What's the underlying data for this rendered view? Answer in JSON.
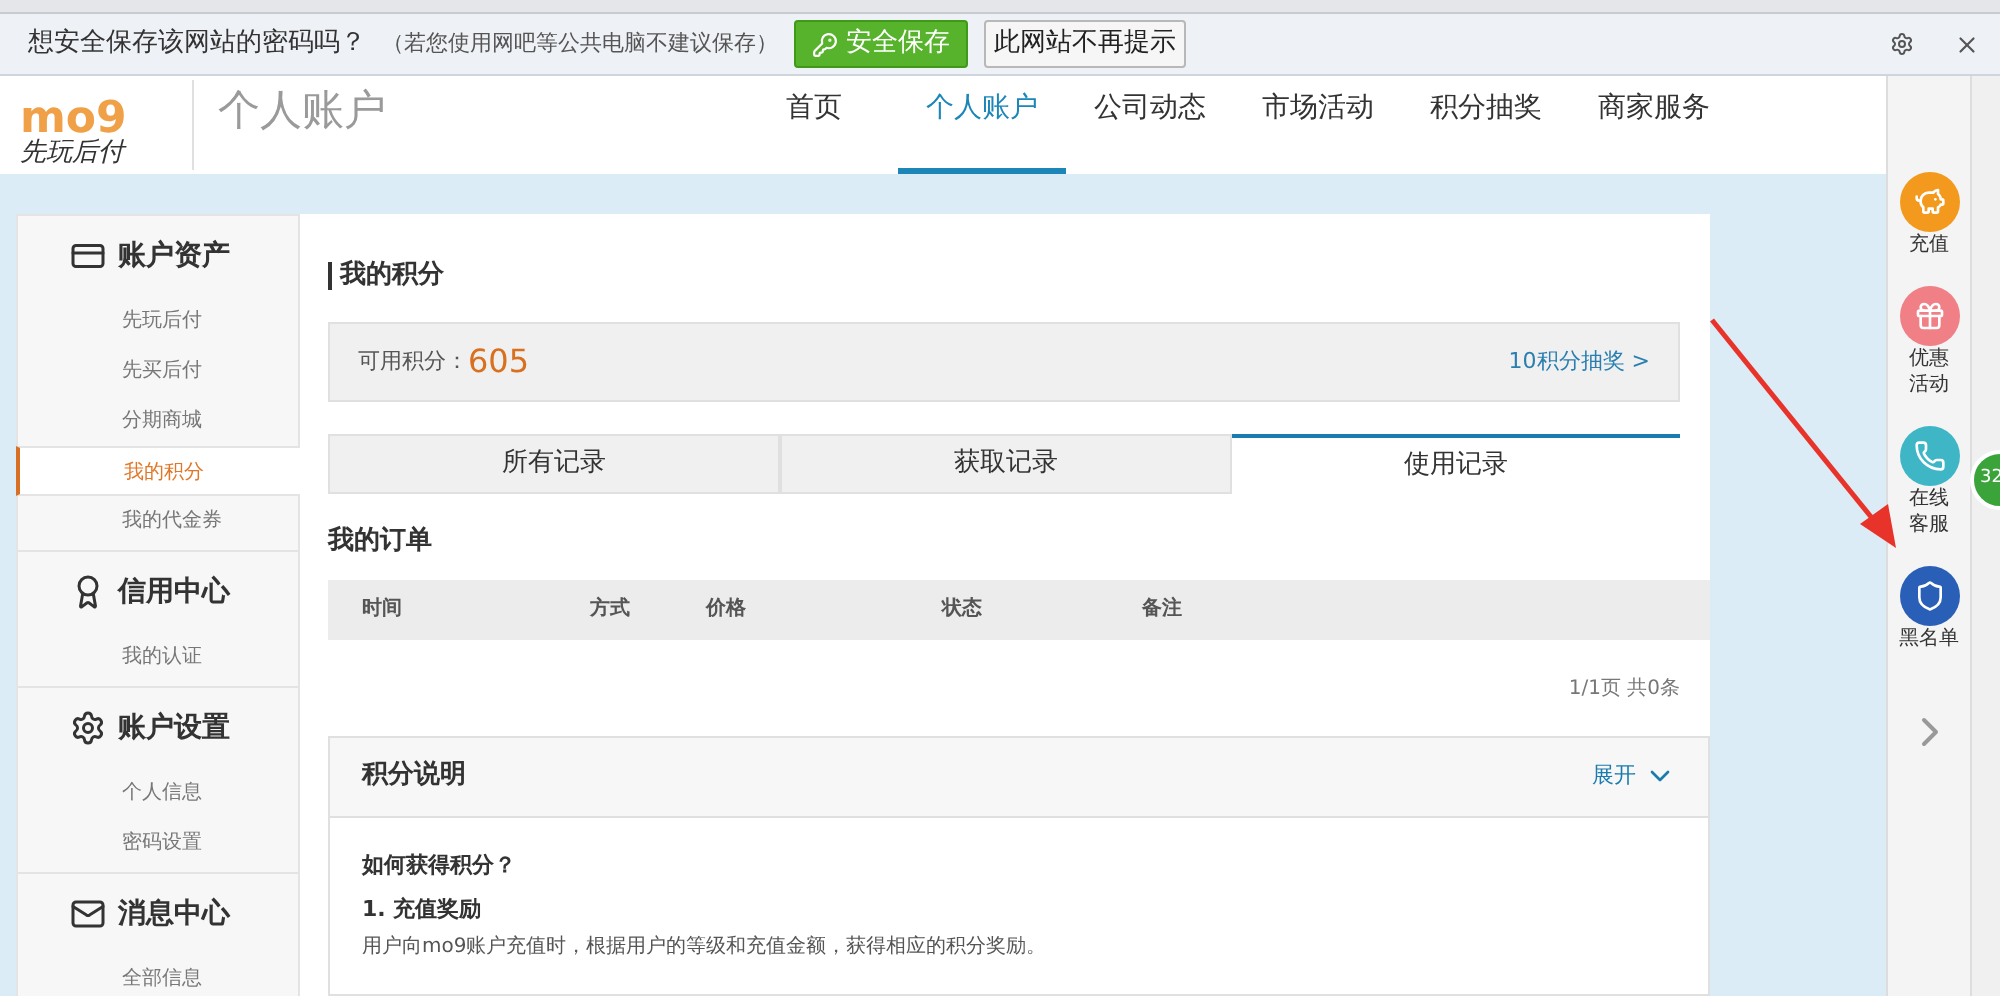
{
  "password_bar": {
    "prompt": "想安全保存该网站的密码吗？",
    "note": "（若您使用网吧等公共电脑不建议保存）",
    "save_button": "安全保存",
    "never_button": "此网站不再提示"
  },
  "header": {
    "logo": {
      "mark": "mo9",
      "slogan": "先玩后付"
    },
    "title": "个人账户",
    "nav": [
      {
        "label": "首页",
        "selected": false
      },
      {
        "label": "个人账户",
        "selected": true
      },
      {
        "label": "公司动态",
        "selected": false
      },
      {
        "label": "市场活动",
        "selected": false
      },
      {
        "label": "积分抽奖",
        "selected": false
      },
      {
        "label": "商家服务",
        "selected": false
      }
    ]
  },
  "sidebar": [
    {
      "title": "账户资产",
      "items": [
        {
          "label": "先玩后付",
          "selected": false
        },
        {
          "label": "先买后付",
          "selected": false
        },
        {
          "label": "分期商城",
          "selected": false
        },
        {
          "label": "我的积分",
          "selected": true
        },
        {
          "label": "我的代金券",
          "selected": false
        }
      ]
    },
    {
      "title": "信用中心",
      "items": [
        {
          "label": "我的认证",
          "selected": false
        }
      ]
    },
    {
      "title": "账户设置",
      "items": [
        {
          "label": "个人信息",
          "selected": false
        },
        {
          "label": "密码设置",
          "selected": false
        }
      ]
    },
    {
      "title": "消息中心",
      "items": [
        {
          "label": "全部信息",
          "selected": false
        }
      ]
    }
  ],
  "main": {
    "title": "我的积分",
    "points": {
      "label": "可用积分：",
      "value": "605",
      "link": "10积分抽奖 >"
    },
    "tabs": [
      {
        "label": "所有记录",
        "selected": false
      },
      {
        "label": "获取记录",
        "selected": false
      },
      {
        "label": "使用记录",
        "selected": true
      }
    ],
    "orders": {
      "title": "我的订单",
      "columns": [
        "时间",
        "方式",
        "价格",
        "状态",
        "备注"
      ],
      "pagination": "1/1页 共0条"
    },
    "explanation": {
      "title": "积分说明",
      "toggle": "展开",
      "expanded": false,
      "question": "如何获得积分？",
      "section": "1. 充值奖励",
      "body": "用户向mo9账户充值时，根据用户的等级和充值金额，获得相应的积分奖励。"
    }
  },
  "float_bar": {
    "items": [
      {
        "label": "充值",
        "color": "#f39a1e"
      },
      {
        "label": "优惠活动",
        "color": "#f07f86"
      },
      {
        "label": "在线客服",
        "color": "#3fb6c6"
      },
      {
        "label": "黑名单",
        "color": "#2a5fb8"
      }
    ],
    "badge": "32"
  }
}
